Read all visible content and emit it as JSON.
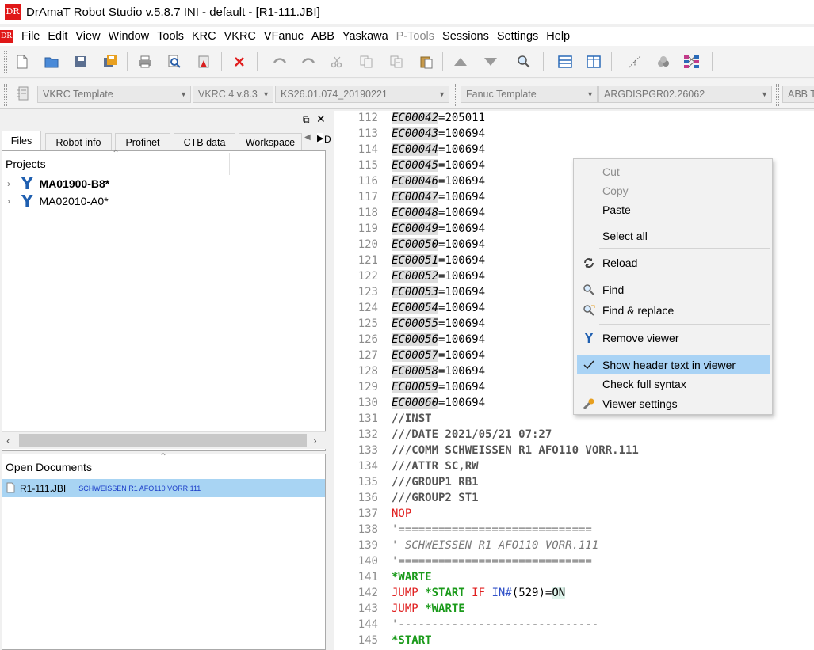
{
  "window": {
    "title": "DrAmaT Robot Studio v.5.8.7 INI - default - [R1-111.JBI]",
    "logo_text": "DR"
  },
  "menu": {
    "items": [
      "File",
      "Edit",
      "View",
      "Window",
      "Tools",
      "KRC",
      "VKRC",
      "VFanuc",
      "ABB",
      "Yaskawa",
      "P-Tools",
      "Sessions",
      "Settings",
      "Help"
    ],
    "disabled": [
      "P-Tools"
    ]
  },
  "toolbar2": {
    "vkrc_template": "VKRC Template",
    "vkrc_version": "VKRC 4 v.8.3",
    "ks_version": "KS26.01.074_20190221",
    "fanuc_template": "Fanuc Template",
    "fanuc_version": "ARGDISPGR02.26062",
    "abb_template": "ABB Te"
  },
  "panel": {
    "tabs": [
      "Files",
      "Robot info",
      "Profinet",
      "CTB data",
      "Workspace",
      "D"
    ],
    "active_tab": "Files",
    "projects_header": "Projects",
    "projects": [
      {
        "name": "MA01900-B8*",
        "bold": true
      },
      {
        "name": "MA02010-A0*",
        "bold": false
      }
    ],
    "open_documents_header": "Open Documents",
    "open_documents": [
      {
        "file": "R1-111.JBI",
        "description": "SCHWEISSEN R1 AFO110 VORR.111"
      }
    ]
  },
  "editor": {
    "lines": [
      {
        "n": "112",
        "key": "EC00042",
        "val": "=205011"
      },
      {
        "n": "113",
        "key": "EC00043",
        "val": "=100694"
      },
      {
        "n": "114",
        "key": "EC00044",
        "val": "=100694"
      },
      {
        "n": "115",
        "key": "EC00045",
        "val": "=100694"
      },
      {
        "n": "116",
        "key": "EC00046",
        "val": "=100694"
      },
      {
        "n": "117",
        "key": "EC00047",
        "val": "=100694"
      },
      {
        "n": "118",
        "key": "EC00048",
        "val": "=100694"
      },
      {
        "n": "119",
        "key": "EC00049",
        "val": "=100694"
      },
      {
        "n": "120",
        "key": "EC00050",
        "val": "=100694"
      },
      {
        "n": "121",
        "key": "EC00051",
        "val": "=100694"
      },
      {
        "n": "122",
        "key": "EC00052",
        "val": "=100694"
      },
      {
        "n": "123",
        "key": "EC00053",
        "val": "=100694"
      },
      {
        "n": "124",
        "key": "EC00054",
        "val": "=100694"
      },
      {
        "n": "125",
        "key": "EC00055",
        "val": "=100694"
      },
      {
        "n": "126",
        "key": "EC00056",
        "val": "=100694"
      },
      {
        "n": "127",
        "key": "EC00057",
        "val": "=100694"
      },
      {
        "n": "128",
        "key": "EC00058",
        "val": "=100694"
      },
      {
        "n": "129",
        "key": "EC00059",
        "val": "=100694"
      },
      {
        "n": "130",
        "key": "EC00060",
        "val": "=100694"
      }
    ],
    "tail": [
      {
        "n": "131",
        "text": "//INST",
        "style": "cmt2"
      },
      {
        "n": "132",
        "text": "///DATE 2021/05/21 07:27",
        "style": "cmt2"
      },
      {
        "n": "133",
        "text": "///COMM SCHWEISSEN R1 AFO110 VORR.111",
        "style": "cmt2"
      },
      {
        "n": "134",
        "text": "///ATTR SC,RW",
        "style": "cmt2"
      },
      {
        "n": "135",
        "text": "///GROUP1 RB1",
        "style": "cmt2"
      },
      {
        "n": "136",
        "text": "///GROUP2 ST1",
        "style": "cmt2"
      },
      {
        "n": "137",
        "text": "NOP",
        "style": "red"
      },
      {
        "n": "138",
        "text": "'=============================",
        "style": "cmt"
      },
      {
        "n": "139",
        "text": "' SCHWEISSEN R1 AFO110 VORR.111",
        "style": "cmt"
      },
      {
        "n": "140",
        "text": "'=============================",
        "style": "cmt"
      },
      {
        "n": "141",
        "text": "*WARTE",
        "style": "grn"
      },
      {
        "n": "142",
        "text": "",
        "style": "jump1"
      },
      {
        "n": "143",
        "text": "",
        "style": "jump2"
      },
      {
        "n": "144",
        "text": "'------------------------------",
        "style": "cmt"
      },
      {
        "n": "145",
        "text": "*START",
        "style": "grn"
      }
    ],
    "jump1": {
      "kw": "JUMP",
      "label": "*START",
      "if": "IF",
      "in": "IN#",
      "arg": "(529)=",
      "on": "ON"
    },
    "jump2": {
      "kw": "JUMP",
      "label": "*WARTE"
    }
  },
  "context_menu": {
    "cut": "Cut",
    "copy": "Copy",
    "paste": "Paste",
    "select_all": "Select all",
    "reload": "Reload",
    "find": "Find",
    "find_replace": "Find & replace",
    "remove_viewer": "Remove viewer",
    "show_header": "Show header text in viewer",
    "check_syntax": "Check full syntax",
    "viewer_settings": "Viewer settings"
  }
}
